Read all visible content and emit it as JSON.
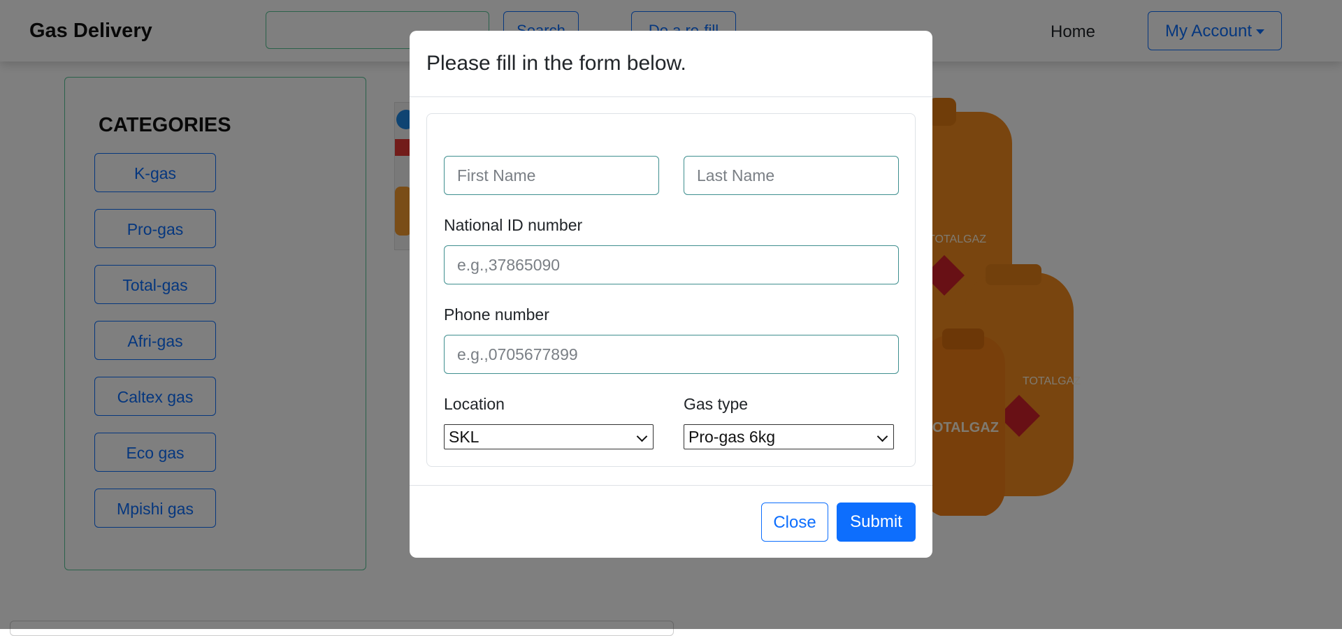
{
  "navbar": {
    "brand": "Gas Delivery",
    "search_button": "Search",
    "refill_button": "Do a re-fill",
    "home_link": "Home",
    "account_button": "My Account"
  },
  "categories": {
    "title": "CATEGORIES",
    "items": [
      {
        "label": "K-gas"
      },
      {
        "label": "Pro-gas"
      },
      {
        "label": "Total-gas"
      },
      {
        "label": "Afri-gas"
      },
      {
        "label": "Caltex gas"
      },
      {
        "label": "Eco gas"
      },
      {
        "label": "Mpishi gas"
      }
    ]
  },
  "hero": {
    "cylinder_brand": "TOTALGAZ",
    "cylinder_color": "#f28a1e"
  },
  "modal": {
    "title": "Please fill in the form below.",
    "first_name_placeholder": "First Name",
    "last_name_placeholder": "Last Name",
    "national_id_label": "National ID number",
    "national_id_placeholder": "e.g.,37865090",
    "phone_label": "Phone number",
    "phone_placeholder": "e.g.,0705677899",
    "location_label": "Location",
    "location_value": "SKL",
    "gas_type_label": "Gas type",
    "gas_type_value": "Pro-gas 6kg",
    "close_button": "Close",
    "submit_button": "Submit"
  },
  "colors": {
    "primary": "#0d6efd",
    "accent_border": "#56c596",
    "backdrop": "rgba(0,0,0,0.5)"
  }
}
